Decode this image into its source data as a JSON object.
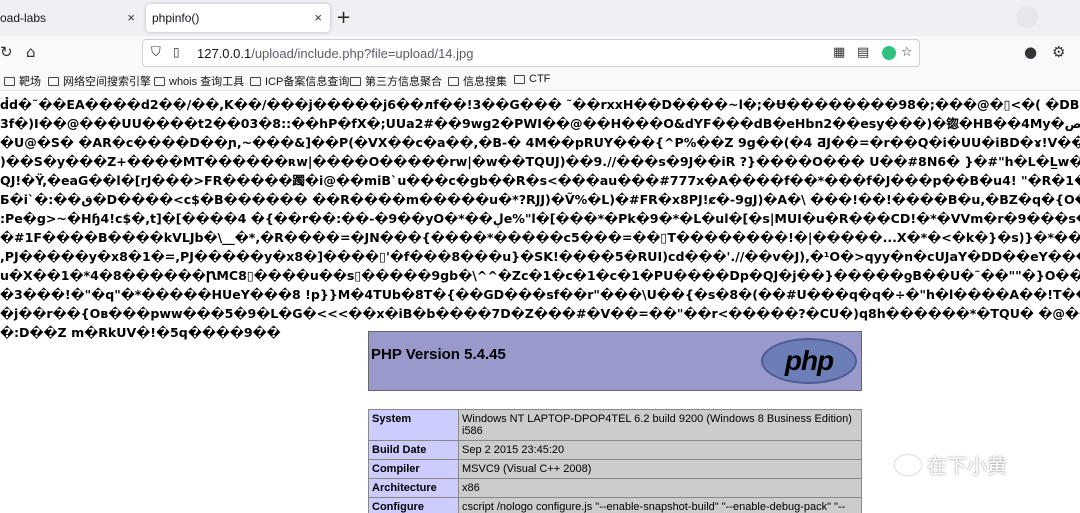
{
  "tabs": [
    {
      "title": "oad-labs",
      "close": "×"
    },
    {
      "title": "phpinfo()",
      "close": "×"
    }
  ],
  "new_tab": "+",
  "toolbar": {
    "back_icon": "arrow-left-icon",
    "home_icon": "home-icon",
    "url_host": "127.0.0.1",
    "url_path": "/upload/include.php?file=upload/14.jpg"
  },
  "bookmarks": [
    "靶场",
    "网络空间搜索引擎",
    "whois 查询工具",
    "ICP备案信息查询",
    "第三方信息聚合",
    "信息搜集",
    "CTF"
  ],
  "garbled_lines": [
    "ḋd�˜��EA����d2��/��,K��/���j�����j6��ᴫf��!3��G��� ˜��rxxH��D����~l�;�Ʉ��������98�;���@�▯<�( �DBEQEQEQEQEQ",
    "3f�)I��@���UU����t2��03�8::��hP�fX�;UUa2#��9wg2�PWI��@��H���O&dYF���dB�eHbn2��esy���)�锪�HB��4My�ص�x�$BH\"��)",
    "�U@�S� �AR�c����D��ɲ,~���&]��P(�VX��c�a��,�B-� 4M��pRUY���{^P%��Z 9g��(�4 ƋJ��=�r��Q�i�UU�iBD�ɤ!V��s �0�qα,m�'",
    ")��S�y���Z+����MT������ʀw|����O�����rw|�w��TQUJ)��9.//���s�9J��iR ?}����O��� U��#8N6� }�#\"h�L�L̲w�V\"����3�VVWW",
    "QJ!�Ÿ,�eaG��l�[rJ���>FR�����躅�i@��miB`u���c�gb��R�s<���au���#777x�A����f��*���f�J���p��B�u4! \"�R�1�*��3�4�@�'Б",
    "Ƃ�i`�:��ق�D����<c$�B������ ��R����m�����u�*?RJJ)�Ṽ%�L)�#FR�x8PJ!ȼ�-9gJ)�A�\\ ���!��!����B�u,�BZ�q�{O�u���xd",
    ":Pe�g>~�Hɧ4!c$�,t]�[����4 �{��r��:��-�9��yO�*��ڸe%\"l�[���*�Pk�9�*�L�ul�[�s|MUI�u�R���CD!�*�VVm�r�9���s�m[��-�TQU�",
    "�#1F����B����kVLJb�\\__�*,�R����=�JN���{����*�����c5���=��▯T��������!�|�����...X�*�<�k�}�s)}�*��xwG�4�1����-",
    ",PJ�����y�x8�1�=,PJ�����y�x8�]����▯'�f���8���u}�SK!����5�RUI)cd���'.//��v�J),�¹O�>qyy�n�cUJaY�DD��eY����{b��A��R",
    "u�X��1�*4�8������ꞂMC8▯����u��s▯�����9gb�\\^^�Zc�1�c�1�c�1�PU����Dp�QJ�j��}�����ƍB��U�˜��\"\"�}O�����n�3URJ",
    "�3���!�\"�q\"�*�����HUeY���8 !p}}M�4TUb�8T�{��GD���sf��r\"���\\U��{�s�8�(��#U���q�q�÷�\"h�l����A��!T��3!��R\"��w��",
    "�j��r��{Oв���pww���5�9�L�G�<<<��x�iB�b����7D�Z���#�V��=��\"��r<�����?�CU�)q8h������*�TQU� �@���i蹦�m��c�1�",
    "�:D��Z m�RkUV�!�5q����9��"
  ],
  "php": {
    "version_title": "PHP Version 5.4.45",
    "logo_text": "php",
    "rows": [
      {
        "key": "System",
        "value": "Windows NT LAPTOP-DPOP4TEL 6.2 build 9200 (Windows 8 Business Edition) i586"
      },
      {
        "key": "Build Date",
        "value": "Sep 2 2015 23:45:20"
      },
      {
        "key": "Compiler",
        "value": "MSVC9 (Visual C++ 2008)"
      },
      {
        "key": "Architecture",
        "value": "x86"
      },
      {
        "key": "Configure Command",
        "value": "cscript /nologo configure.js \"--enable-snapshot-build\" \"--enable-debug-pack\" \"--disable-zts\" \"--disable-isapi\" \"--disable-nsapi\" \"--without-mssql\" \"--without-pdo-"
      }
    ]
  },
  "watermark": "在下小黄"
}
